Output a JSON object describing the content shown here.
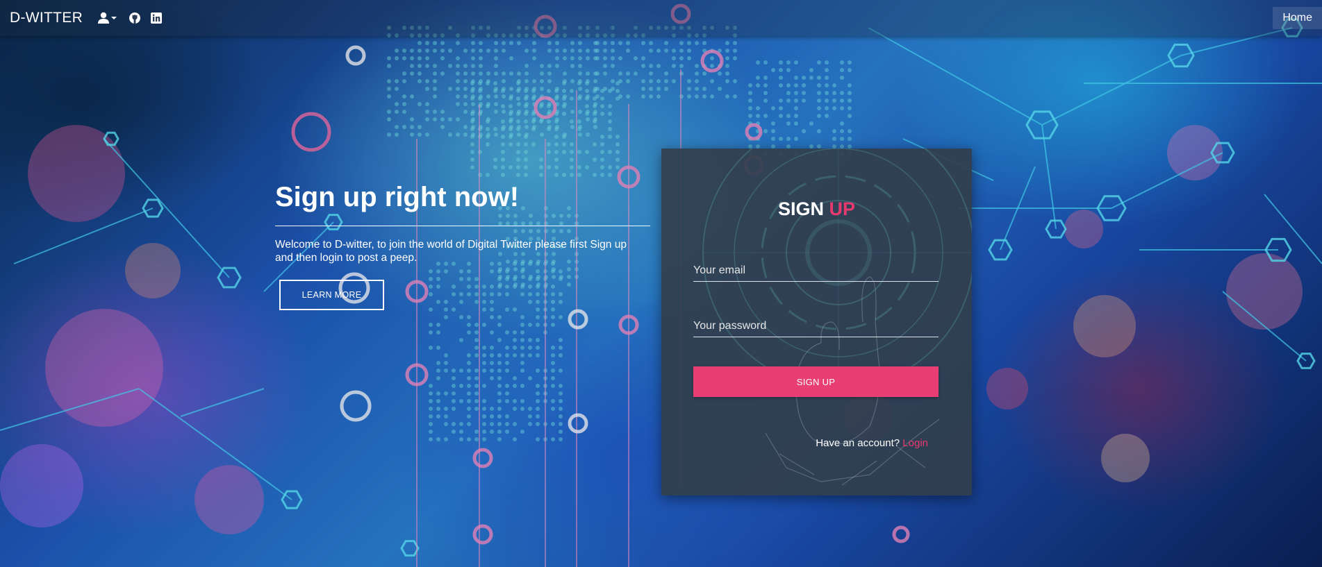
{
  "navbar": {
    "brand": "D-WITTER",
    "icons": [
      "user-dropdown-icon",
      "github-icon",
      "linkedin-icon"
    ],
    "home_label": "Home"
  },
  "hero": {
    "title": "Sign up right now!",
    "description": "Welcome to D-witter, to join the world of Digital Twitter please first Sign up and then login to post a peep.",
    "learn_more_label": "LEARN MORE"
  },
  "signup_card": {
    "title_part1": "SIGN",
    "title_part2": "UP",
    "email_placeholder": "Your email",
    "password_placeholder": "Your password",
    "submit_label": "SIGN UP",
    "have_account_text": "Have an account?",
    "login_label": "Login"
  },
  "colors": {
    "accent": "#e8396f",
    "button": "#e83e74",
    "card_bg": "#323e4e",
    "text": "#ffffff"
  }
}
